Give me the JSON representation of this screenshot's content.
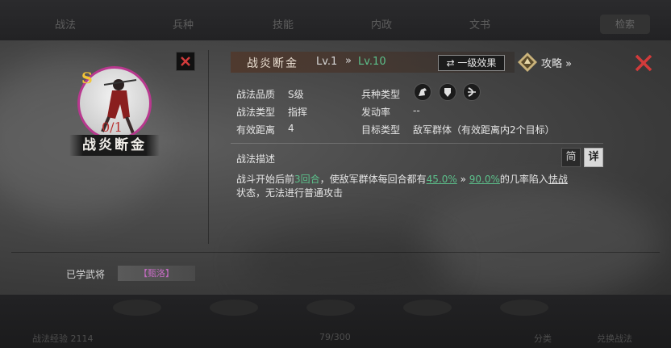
{
  "background_ui": {
    "tabs": [
      "战法",
      "兵种",
      "技能",
      "内政",
      "文书"
    ],
    "search_label": "检索",
    "footer": {
      "left_text": "战法经验 2114",
      "center_text": "79/300",
      "right_1": "分类",
      "right_2": "兑换战法"
    }
  },
  "tactic": {
    "grade_letter": "S",
    "stars": "0/1",
    "name": "战炎断金",
    "level_from": "Lv.1",
    "level_arrow": "»",
    "level_to": "Lv.10"
  },
  "buttons": {
    "effect_label": "⇄ 一级效果",
    "guide_label": "攻略 »",
    "simple_label": "简",
    "detail_label": "详"
  },
  "stats": {
    "quality_label": "战法品质",
    "quality_value": "S级",
    "type_label": "战法类型",
    "type_value": "指挥",
    "range_label": "有效距离",
    "range_value": "4",
    "troop_label": "兵种类型",
    "troop_icons": [
      "cavalry-icon",
      "shield-icon",
      "bow-icon"
    ],
    "rate_label": "发动率",
    "rate_value": "--",
    "target_label": "目标类型",
    "target_value": "敌军群体（有效距离内2个目标）"
  },
  "description": {
    "label": "战法描述",
    "p1": "战斗开始后前",
    "p2": "3回合",
    "p3": "，使敌军群体每回合都有",
    "p4": "45.0%",
    "p5": " » ",
    "p6": "90.0%",
    "p7": "的几率陷入",
    "p8": "怯战",
    "p9": "状态，无法进行普通攻击"
  },
  "learned": {
    "label": "已学武将",
    "general": "【甄洛】"
  },
  "colors": {
    "accent_green": "#5cc08b",
    "close_red": "#d23b3b",
    "grade_gold": "#f2c436",
    "portrait_ring": "#b8388e",
    "learned_purple": "#c36bc1"
  }
}
